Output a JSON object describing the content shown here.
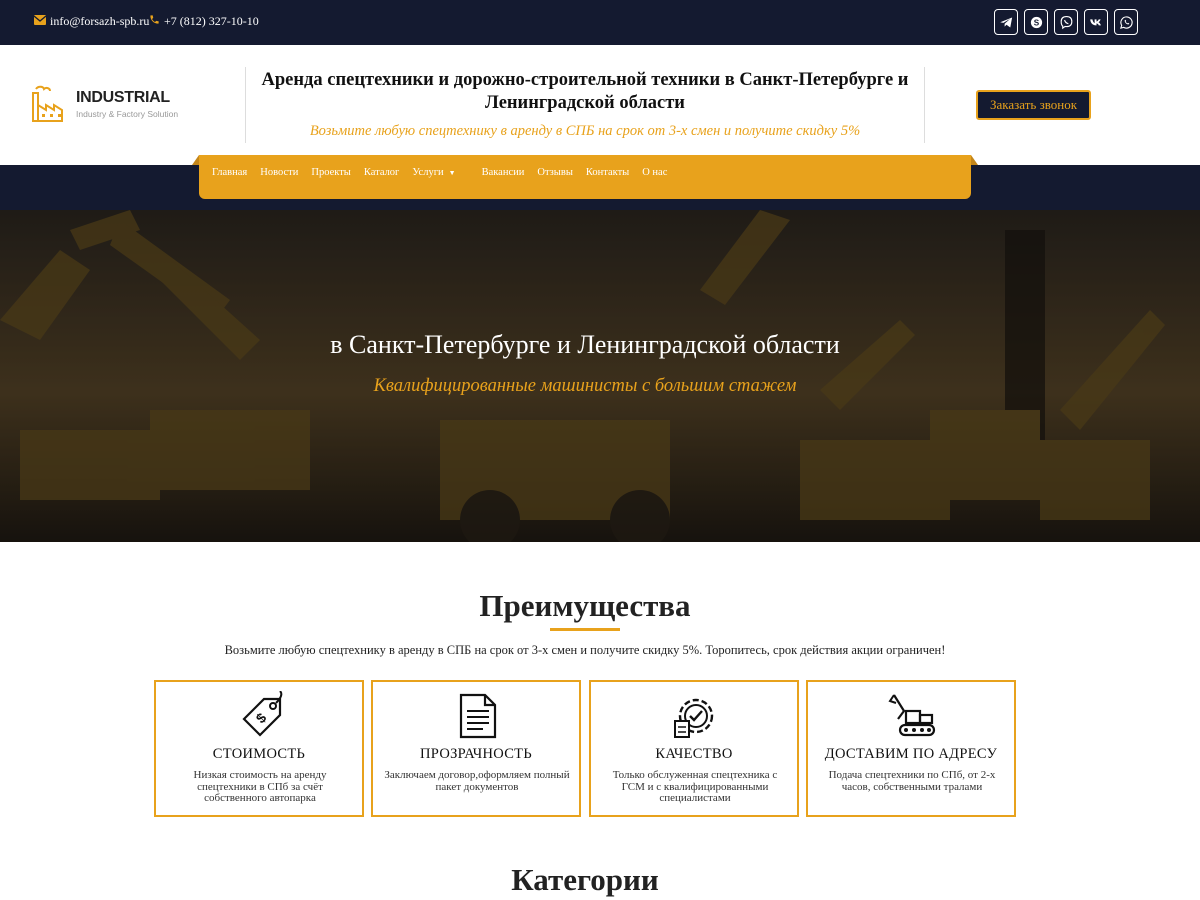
{
  "topbar": {
    "email": "info@forsazh-spb.ru",
    "phone": "+7 (812) 327-10-10",
    "socials": [
      "telegram-icon",
      "skype-icon",
      "viber-icon",
      "vk-icon",
      "whatsapp-icon"
    ]
  },
  "header": {
    "logo_name": "INDUSTRIAL",
    "logo_tagline": "Industry & Factory Solution",
    "title": "Аренда спецтехники и дорожно-строительной техники в Санкт-Петербурге и Ленинградской области",
    "subtitle": "Возьмите любую спецтехнику в аренду в СПБ на срок от 3-х смен и получите скидку 5%",
    "call_button": "Заказать звонок"
  },
  "nav": {
    "items": [
      {
        "label": "Главная"
      },
      {
        "label": "Новости"
      },
      {
        "label": "Проекты"
      },
      {
        "label": "Каталог"
      },
      {
        "label": "Услуги"
      },
      {
        "label": "Вакансии"
      },
      {
        "label": "Отзывы"
      },
      {
        "label": "Контакты"
      },
      {
        "label": "О нас"
      }
    ]
  },
  "hero": {
    "title": "в Санкт-Петербурге и Ленинградской области",
    "subtitle": "Квалифицированные машинисты с большим стажем"
  },
  "advantages": {
    "title": "Преимущества",
    "description": "Возьмите любую спецтехнику в аренду в СПБ на срок от 3-х смен и получите скидку 5%. Торопитесь, срок действия акции ограничен!",
    "cards": [
      {
        "icon": "price-tag-icon",
        "title": "СТОИМОСТЬ",
        "text": "Низкая стоимость на аренду спецтехники в СПб за счёт собственного автопарка"
      },
      {
        "icon": "document-icon",
        "title": "ПРОЗРАЧНОСТЬ",
        "text": "Заключаем договор,оформляем полный пакет документов"
      },
      {
        "icon": "quality-gear-icon",
        "title": "КАЧЕСТВО",
        "text": "Только обслуженная спецтехника с ГСМ и с квалифицированными специалистами"
      },
      {
        "icon": "excavator-icon",
        "title": "ДОСТАВИМ ПО АДРЕСУ",
        "text": "Подача спецтехники по СПб, от 2-х часов, собственными тралами"
      }
    ]
  },
  "categories": {
    "title": "Категории"
  },
  "colors": {
    "accent": "#e8a21c",
    "dark": "#141a30"
  }
}
